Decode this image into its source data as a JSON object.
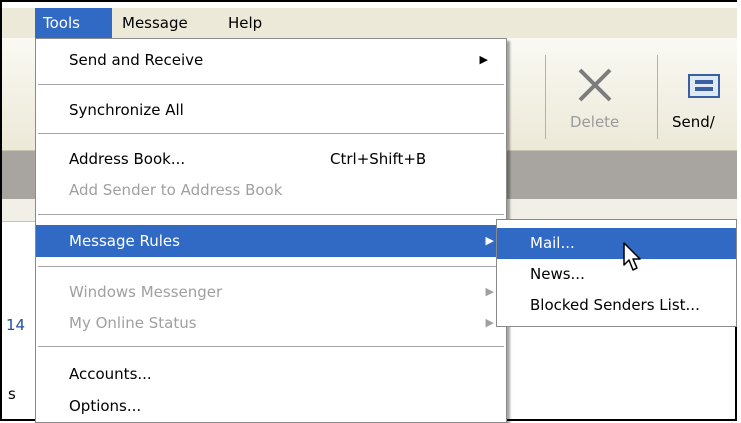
{
  "menubar": {
    "items": [
      "Tools",
      "Message",
      "Help"
    ],
    "active": "Tools"
  },
  "toolbar": {
    "delete_label": "Delete",
    "send_label": "Send/"
  },
  "background_text": {
    "line1": "14",
    "line2": "s"
  },
  "tools_menu": {
    "send_receive": "Send and Receive",
    "synchronize_all": "Synchronize All",
    "address_book": "Address Book...",
    "address_book_shortcut": "Ctrl+Shift+B",
    "add_sender": "Add Sender to Address Book",
    "message_rules": "Message Rules",
    "windows_messenger": "Windows Messenger",
    "my_online_status": "My Online Status",
    "accounts": "Accounts...",
    "options": "Options..."
  },
  "message_rules_submenu": {
    "mail": "Mail...",
    "news": "News...",
    "blocked_senders": "Blocked Senders List..."
  },
  "colors": {
    "highlight": "#316ac5",
    "menubar_bg": "#ece9d8",
    "disabled_text": "#a0a0a0"
  }
}
